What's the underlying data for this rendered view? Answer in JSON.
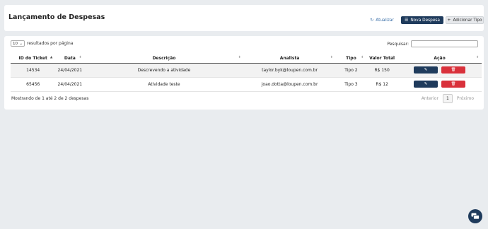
{
  "header": {
    "title": "Lançamento de Despesas",
    "refresh_label": "Atualizar",
    "new_label": "Nova Despesa",
    "add_type_label": "Adicionar Tipo"
  },
  "controls": {
    "length_value": "10",
    "length_suffix": "resultados por página",
    "search_label": "Pesquisar:"
  },
  "table": {
    "columns": [
      "ID do Ticket",
      "Data",
      "Descrição",
      "Analista",
      "Tipo",
      "Valor Total",
      "Ação"
    ],
    "rows": [
      [
        "14534",
        "24/04/2021",
        "Descrevendo a atividade",
        "taylor.byk@loupen.com.br",
        "Tipo 2",
        "R$ 150"
      ],
      [
        "65456",
        "24/04/2021",
        "Atividade teste",
        "joao.dotta@loupen.com.br",
        "Tipo 3",
        "R$ 12"
      ]
    ]
  },
  "footer": {
    "info": "Mostrando de 1 até 2 de 2 despesas",
    "prev": "Anterior",
    "page": "1",
    "next": "Próximo"
  },
  "colors": {
    "primary": "#1f3b5c",
    "danger": "#d9313b",
    "background": "#e9ecef"
  }
}
